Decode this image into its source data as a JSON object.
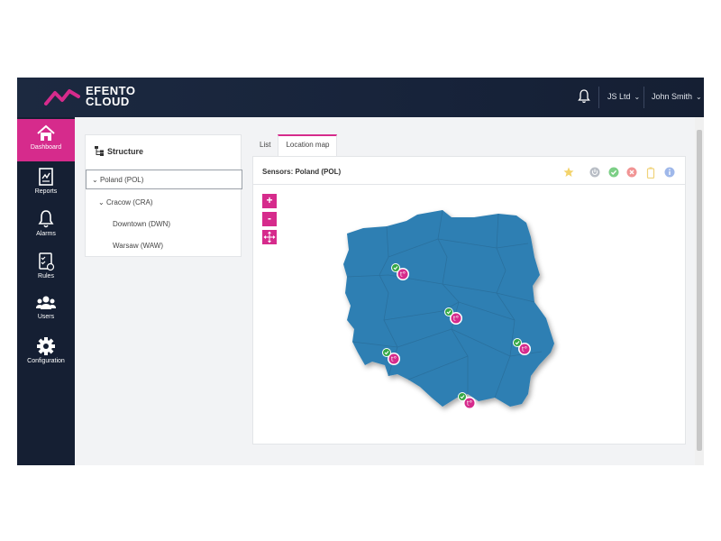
{
  "brand": {
    "line1": "EFENTO",
    "line2": "CLOUD",
    "accent": "#d62b8c"
  },
  "header": {
    "company": "JS Ltd",
    "user": "John Smith"
  },
  "nav": [
    {
      "label": "Dashboard",
      "icon": "home-icon"
    },
    {
      "label": "Reports",
      "icon": "report-icon"
    },
    {
      "label": "Alarms",
      "icon": "bell-icon"
    },
    {
      "label": "Rules",
      "icon": "rules-icon"
    },
    {
      "label": "Users",
      "icon": "users-icon"
    },
    {
      "label": "Configuration",
      "icon": "gear-icon"
    }
  ],
  "structure": {
    "title": "Structure",
    "items": [
      {
        "label": "Poland (POL)",
        "level": 0,
        "expanded": true
      },
      {
        "label": "Cracow (CRA)",
        "level": 1,
        "expanded": true
      },
      {
        "label": "Downtown (DWN)",
        "level": 2
      },
      {
        "label": "Warsaw (WAW)",
        "level": 2
      }
    ]
  },
  "tabs": [
    {
      "label": "List"
    },
    {
      "label": "Location map",
      "active": true
    }
  ],
  "map": {
    "title": "Sensors: Poland (POL)",
    "zoom_in": "+",
    "zoom_out": "-",
    "fill_color": "#2e7fb3",
    "status_color": "#35a845",
    "sensor_color": "#d62b8c",
    "status_icons": [
      "star-icon",
      "power-icon",
      "check-icon",
      "error-icon",
      "battery-icon",
      "info-icon"
    ]
  }
}
